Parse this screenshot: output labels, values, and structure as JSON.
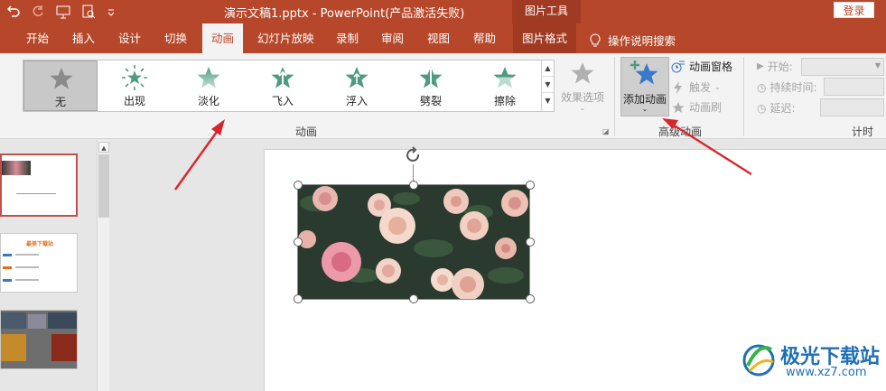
{
  "window": {
    "title": "演示文稿1.pptx  -  PowerPoint(产品激活失败)",
    "context_title": "图片工具",
    "login_label": "登录"
  },
  "tabs": {
    "home": "开始",
    "insert": "插入",
    "design": "设计",
    "transitions": "切换",
    "animations": "动画",
    "slideshow": "幻灯片放映",
    "record": "录制",
    "review": "审阅",
    "view": "视图",
    "help": "帮助",
    "picture_format": "图片格式",
    "tell_me": "操作说明搜索"
  },
  "animation_gallery": {
    "items": [
      {
        "label": "无",
        "icon": "star-gray-icon"
      },
      {
        "label": "出现",
        "icon": "star-burst-icon"
      },
      {
        "label": "淡化",
        "icon": "star-fade-icon"
      },
      {
        "label": "飞入",
        "icon": "star-fly-icon"
      },
      {
        "label": "浮入",
        "icon": "star-float-icon"
      },
      {
        "label": "劈裂",
        "icon": "star-split-icon"
      },
      {
        "label": "擦除",
        "icon": "star-wipe-icon"
      }
    ],
    "group_label": "动画",
    "effect_options": "效果选项"
  },
  "advanced_animation": {
    "add_animation": "添加动画",
    "animation_pane": "动画窗格",
    "trigger": "触发",
    "animation_painter": "动画刷",
    "group_label": "高级动画"
  },
  "timing": {
    "start": "开始:",
    "duration": "持续时间:",
    "delay": "延迟:",
    "group_label": "计时"
  },
  "thumbnails": {
    "slide2_title": "最美下载站"
  },
  "watermark": {
    "name": "极光下载站",
    "url": "www.xz7.com"
  },
  "colors": {
    "accent": "#b7472a",
    "anim_green": "#4e9a82",
    "arrow_red": "#d9262c"
  }
}
